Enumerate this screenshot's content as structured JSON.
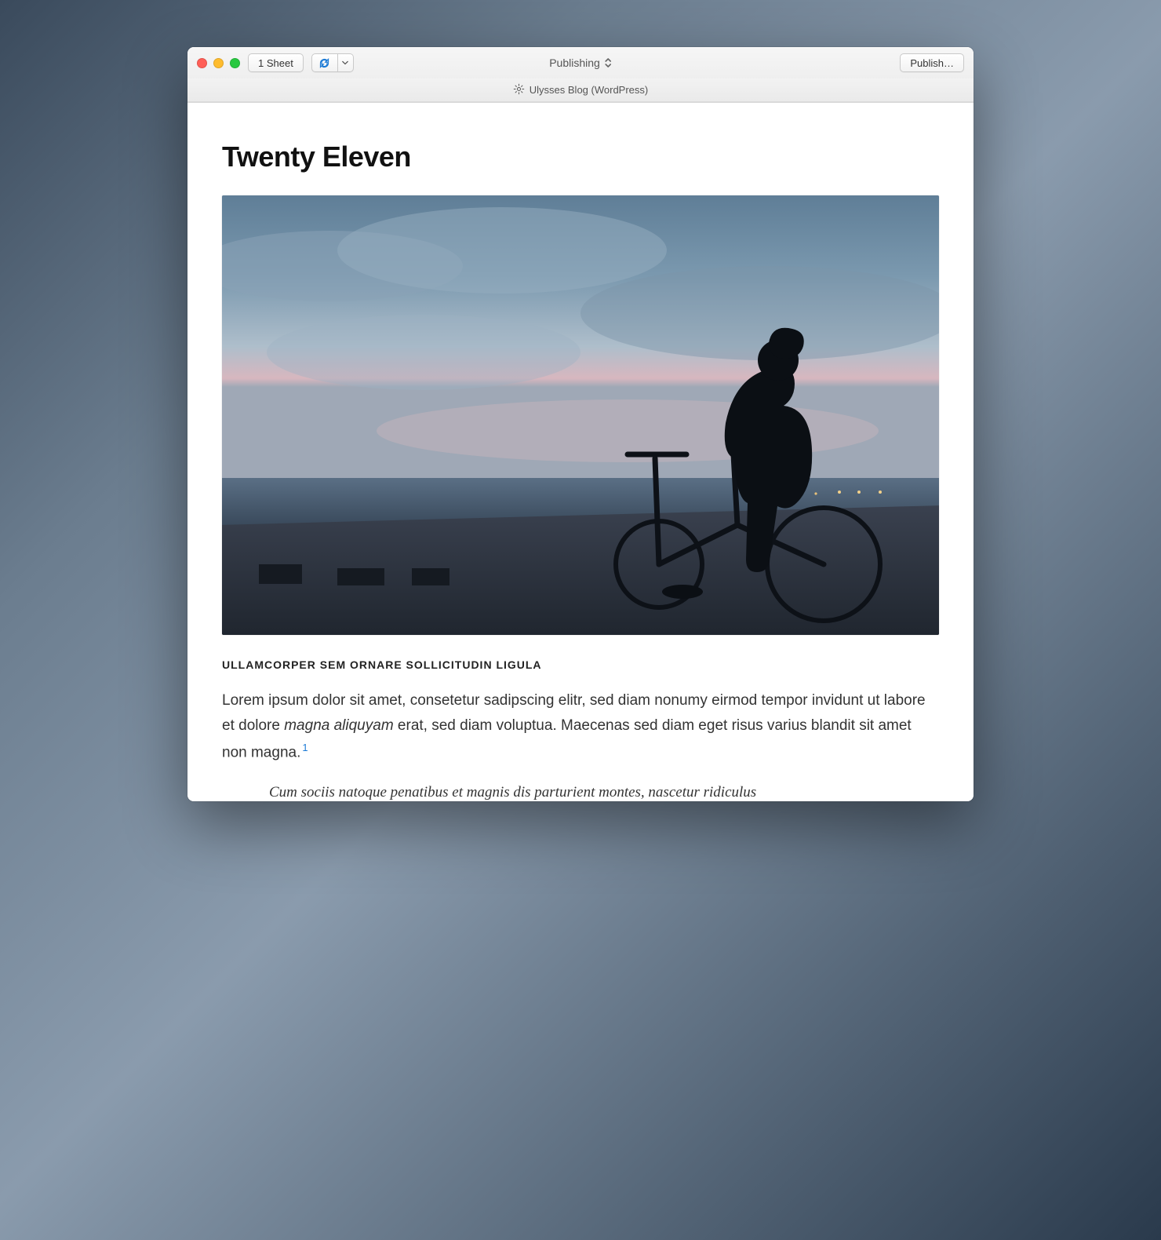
{
  "window": {
    "title_center": "Publishing",
    "sheet_button": "1 Sheet",
    "publish_button": "Publish…"
  },
  "subheader": {
    "blog_label": "Ulysses Blog (WordPress)"
  },
  "post": {
    "title": "Twenty Eleven",
    "subheading": "ULLAMCORPER SEM ORNARE SOLLICITUDIN LIGULA",
    "paragraph_before_em": "Lorem ipsum dolor sit amet, consetetur sadipscing elitr, sed diam nonumy eirmod tempor invidunt ut labore et dolore ",
    "paragraph_em": "magna aliquyam",
    "paragraph_after_em": " erat, sed diam voluptua. Maecenas sed diam eget risus varius blandit sit amet non magna.",
    "footnote_mark": "1",
    "quote": "Cum sociis natoque penatibus et magnis dis parturient montes, nascetur ridiculus"
  },
  "icons": {
    "refresh": "refresh-icon",
    "dropdown_caret": "chevron-down-icon",
    "updown": "updown-icon",
    "gear": "gear-icon"
  }
}
